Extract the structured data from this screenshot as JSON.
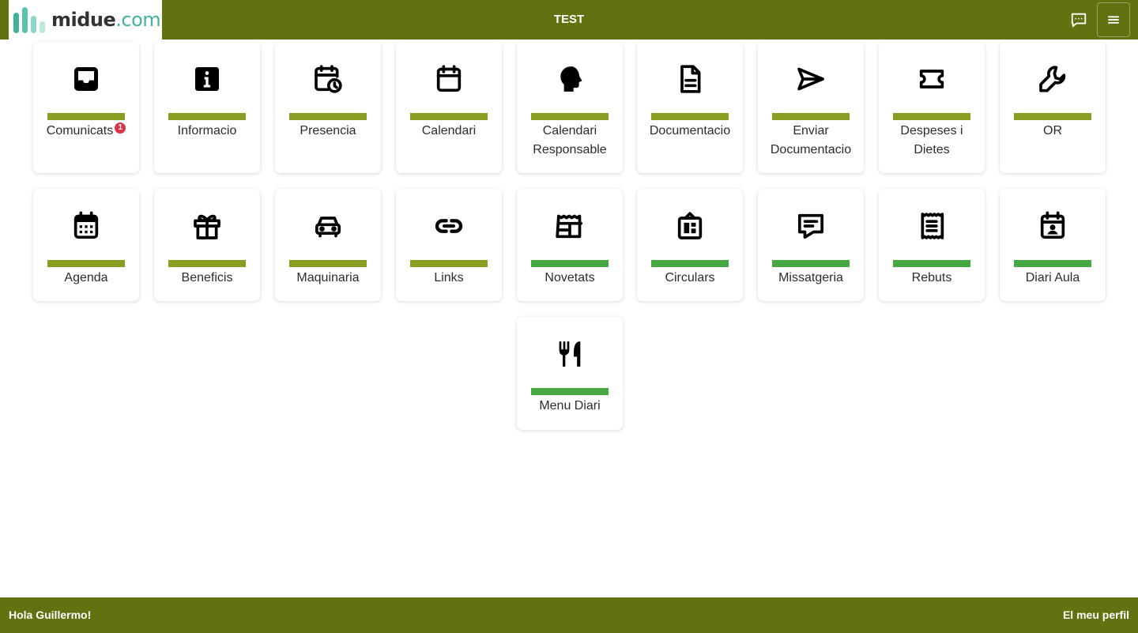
{
  "header": {
    "title": "TEST",
    "logo": {
      "text": "midue",
      "suffix": ".com",
      "bar_colors": [
        "#3fb49a",
        "#5cc4ae",
        "#8fd6c6",
        "#bde6dc"
      ]
    },
    "chat_icon": "chat-icon",
    "menu_icon": "hamburger-menu-icon"
  },
  "colors": {
    "topbar": "#637211",
    "bar_olive": "#8a9e22",
    "bar_green": "#45a843",
    "badge": "#dc3545"
  },
  "tiles": [
    {
      "label": "Comunicats",
      "badge": "1",
      "icon": "inbox-icon",
      "bar": "olive"
    },
    {
      "label": "Informacio",
      "icon": "info-icon",
      "bar": "olive"
    },
    {
      "label": "Presencia",
      "icon": "calendar-clock-icon",
      "bar": "olive"
    },
    {
      "label": "Calendari",
      "icon": "calendar-icon",
      "bar": "olive"
    },
    {
      "label": "Calendari Responsable",
      "icon": "head-profile-icon",
      "bar": "olive"
    },
    {
      "label": "Documentacio",
      "icon": "document-icon",
      "bar": "olive"
    },
    {
      "label": "Enviar Documentacio",
      "icon": "send-icon",
      "bar": "olive"
    },
    {
      "label": "Despeses i Dietes",
      "icon": "ticket-icon",
      "bar": "olive"
    },
    {
      "label": "OR",
      "icon": "wrench-icon",
      "bar": "olive"
    },
    {
      "label": "Agenda",
      "icon": "calendar-grid-icon",
      "bar": "olive"
    },
    {
      "label": "Beneficis",
      "icon": "gift-icon",
      "bar": "olive"
    },
    {
      "label": "Maquinaria",
      "icon": "car-icon",
      "bar": "olive"
    },
    {
      "label": "Links",
      "icon": "link-icon",
      "bar": "olive"
    },
    {
      "label": "Novetats",
      "icon": "news-icon",
      "bar": "green"
    },
    {
      "label": "Circulars",
      "icon": "notice-board-icon",
      "bar": "green"
    },
    {
      "label": "Missatgeria",
      "icon": "message-icon",
      "bar": "green"
    },
    {
      "label": "Rebuts",
      "icon": "receipt-icon",
      "bar": "green"
    },
    {
      "label": "Diari Aula",
      "icon": "calendar-person-icon",
      "bar": "green"
    },
    {
      "label": "Menu Diari",
      "icon": "fork-knife-icon",
      "bar": "green"
    }
  ],
  "footer": {
    "greeting": "Hola Guillermo!",
    "profile_link": "El meu perfil"
  }
}
